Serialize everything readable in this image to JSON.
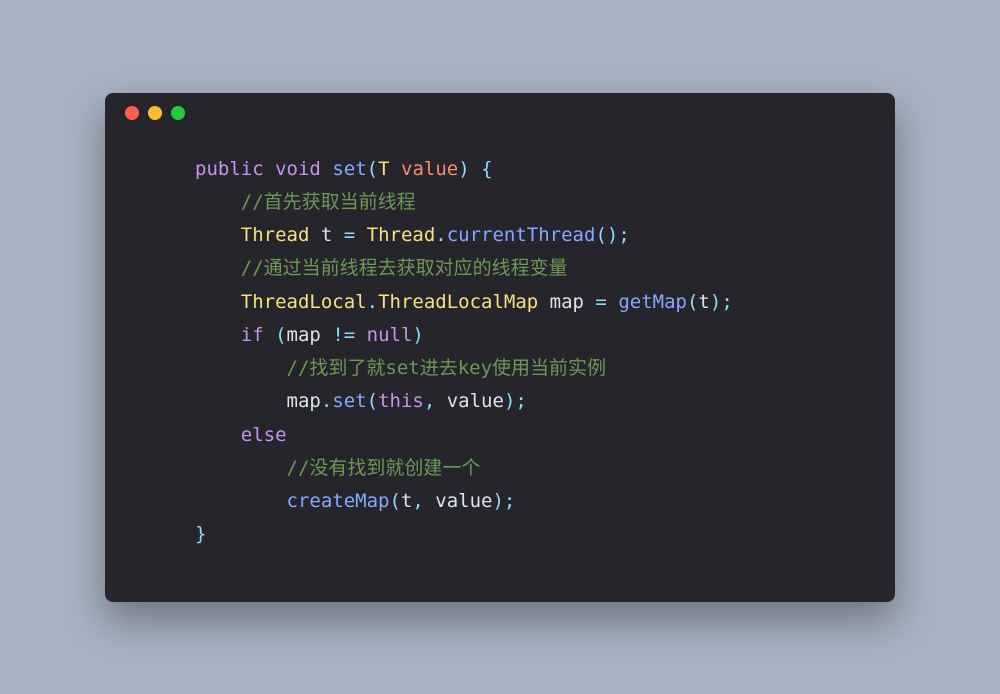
{
  "code": {
    "l1": {
      "public": "public",
      "void": "void",
      "fn": "set",
      "lp": "(",
      "T": "T",
      "param": "value",
      "rp": ")",
      "brace": " {"
    },
    "l2": {
      "comment": "//首先获取当前线程"
    },
    "l3": {
      "cls1": "Thread",
      "var": " t ",
      "eq": "=",
      "cls2": " Thread",
      "dot": ".",
      "fn": "currentThread",
      "paren": "()",
      "semi": ";"
    },
    "l4": {
      "comment": "//通过当前线程去获取对应的线程变量"
    },
    "l5": {
      "cls1": "ThreadLocal",
      "dot1": ".",
      "cls2": "ThreadLocalMap",
      "var": " map ",
      "eq": "=",
      "fn": " getMap",
      "lp": "(",
      "arg": "t",
      "rp": ")",
      "semi": ";"
    },
    "l6": {
      "if": "if",
      "lp": " (",
      "var": "map ",
      "neq": "!=",
      "null": " null",
      "rp": ")"
    },
    "l7": {
      "comment": "//找到了就set进去key使用当前实例"
    },
    "l8": {
      "obj": "map",
      "dot": ".",
      "fn": "set",
      "lp": "(",
      "this": "this",
      "comma": ", ",
      "arg": "value",
      "rp": ")",
      "semi": ";"
    },
    "l9": {
      "else": "else"
    },
    "l10": {
      "comment": "//没有找到就创建一个"
    },
    "l11": {
      "fn": "createMap",
      "lp": "(",
      "a1": "t",
      "comma": ", ",
      "a2": "value",
      "rp": ")",
      "semi": ";"
    },
    "l12": {
      "brace": "}"
    }
  }
}
